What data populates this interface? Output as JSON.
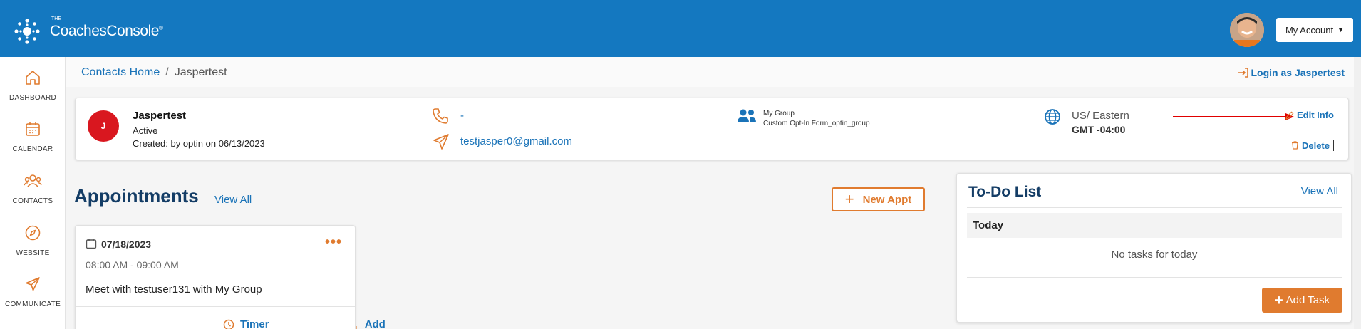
{
  "app": {
    "logo_small": "THE",
    "logo_text": "CoachesConsole",
    "logo_mark": "®"
  },
  "header": {
    "account_label": "My Account"
  },
  "sidebar": {
    "items": [
      {
        "label": "DASHBOARD",
        "icon": "home-icon"
      },
      {
        "label": "CALENDAR",
        "icon": "calendar-icon"
      },
      {
        "label": "CONTACTS",
        "icon": "contacts-icon"
      },
      {
        "label": "WEBSITE",
        "icon": "compass-icon"
      },
      {
        "label": "COMMUNICATE",
        "icon": "send-icon"
      }
    ]
  },
  "breadcrumb": {
    "home": "Contacts Home",
    "separator": "/",
    "current": "Jaspertest"
  },
  "login_as": "Login as Jaspertest",
  "contact": {
    "avatar_initial": "J",
    "name": "Jaspertest",
    "status": "Active",
    "created": "Created: by optin on 06/13/2023",
    "phone": "-",
    "email": "testjasper0@gmail.com",
    "group_name": "My Group",
    "group_source": "Custom Opt-In Form_optin_group",
    "timezone": "US/ Eastern",
    "gmt": "GMT -04:00",
    "edit_label": "Edit Info",
    "delete_label": "Delete"
  },
  "appointments": {
    "title": "Appointments",
    "view_all": "View All",
    "new_button": "New Appt",
    "items": [
      {
        "date": "07/18/2023",
        "time": "08:00 AM - 09:00 AM",
        "description": "Meet with testuser131 with My Group",
        "timer_label": "Timer",
        "add_note_label": "Add Note"
      }
    ]
  },
  "todo": {
    "title": "To-Do List",
    "view_all": "View All",
    "section": "Today",
    "empty_text": "No tasks for today",
    "add_button": "Add Task"
  },
  "colors": {
    "header_blue": "#1478c0",
    "accent_orange": "#e07b2f",
    "link_blue": "#1a73b8",
    "avatar_red": "#d9171f",
    "annotation_arrow": "#e00000"
  }
}
